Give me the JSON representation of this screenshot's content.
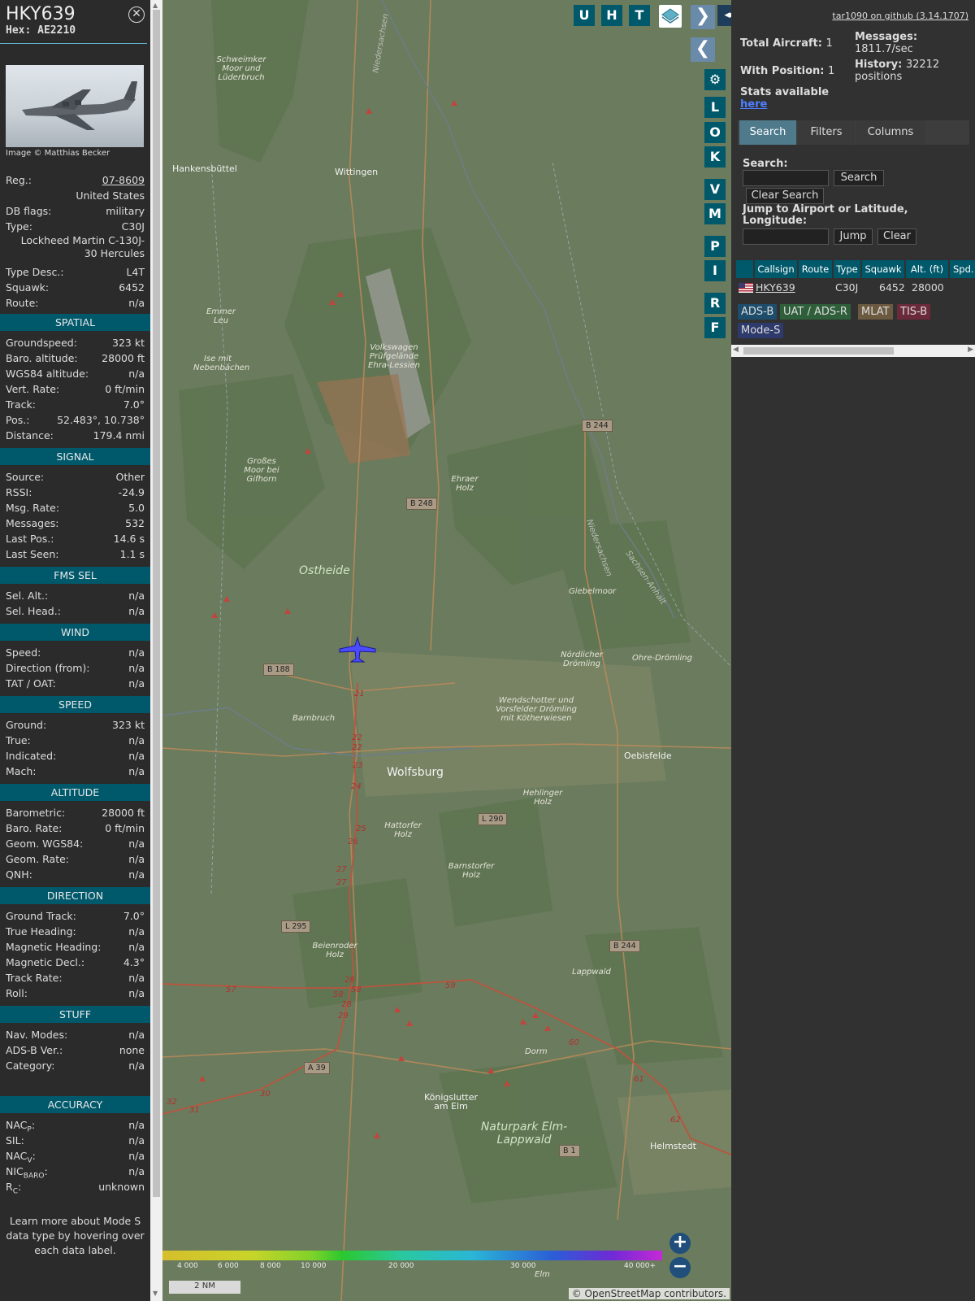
{
  "sidebar": {
    "callsign": "HKY639",
    "hex_label": "Hex:",
    "hex": "AE2210",
    "photo_credit": "Image © Matthias Becker",
    "general": [
      {
        "k": "Reg.:",
        "v": "07-8609",
        "link": true
      },
      {
        "k": "",
        "v": "United States"
      },
      {
        "k": "DB flags:",
        "v": "military"
      },
      {
        "k": "Type:",
        "v": "C30J"
      },
      {
        "k": "",
        "v": "Lockheed Martin C-130J-30 Hercules",
        "tall": true
      },
      {
        "k": "Type Desc.:",
        "v": "L4T"
      },
      {
        "k": "Squawk:",
        "v": "6452"
      },
      {
        "k": "Route:",
        "v": "n/a"
      }
    ],
    "sections": [
      {
        "title": "SPATIAL",
        "rows": [
          {
            "k": "Groundspeed:",
            "v": "323 kt"
          },
          {
            "k": "Baro. altitude:",
            "v": "28000 ft"
          },
          {
            "k": "WGS84 altitude:",
            "v": "n/a"
          },
          {
            "k": "Vert. Rate:",
            "v": "0 ft/min"
          },
          {
            "k": "Track:",
            "v": "7.0°"
          },
          {
            "k": "Pos.:",
            "v": "52.483°, 10.738°"
          },
          {
            "k": "Distance:",
            "v": "179.4 nmi"
          }
        ]
      },
      {
        "title": "SIGNAL",
        "rows": [
          {
            "k": "Source:",
            "v": "Other"
          },
          {
            "k": "RSSI:",
            "v": "-24.9"
          },
          {
            "k": "Msg. Rate:",
            "v": "5.0"
          },
          {
            "k": "Messages:",
            "v": "532"
          },
          {
            "k": "Last Pos.:",
            "v": "14.6 s"
          },
          {
            "k": "Last Seen:",
            "v": "1.1 s"
          }
        ]
      },
      {
        "title": "FMS SEL",
        "rows": [
          {
            "k": "Sel. Alt.:",
            "v": "n/a"
          },
          {
            "k": "Sel. Head.:",
            "v": "n/a"
          }
        ]
      },
      {
        "title": "WIND",
        "rows": [
          {
            "k": "Speed:",
            "v": "n/a"
          },
          {
            "k": "Direction (from):",
            "v": "n/a"
          },
          {
            "k": "TAT / OAT:",
            "v": "n/a"
          }
        ]
      },
      {
        "title": "SPEED",
        "rows": [
          {
            "k": "Ground:",
            "v": "323 kt"
          },
          {
            "k": "True:",
            "v": "n/a"
          },
          {
            "k": "Indicated:",
            "v": "n/a"
          },
          {
            "k": "Mach:",
            "v": "n/a"
          }
        ]
      },
      {
        "title": "ALTITUDE",
        "rows": [
          {
            "k": "Barometric:",
            "v": "28000 ft"
          },
          {
            "k": "Baro. Rate:",
            "v": "0 ft/min"
          },
          {
            "k": "Geom. WGS84:",
            "v": "n/a"
          },
          {
            "k": "Geom. Rate:",
            "v": "n/a"
          },
          {
            "k": "QNH:",
            "v": "n/a"
          }
        ]
      },
      {
        "title": "DIRECTION",
        "rows": [
          {
            "k": "Ground Track:",
            "v": "7.0°"
          },
          {
            "k": "True Heading:",
            "v": "n/a"
          },
          {
            "k": "Magnetic Heading:",
            "v": "n/a"
          },
          {
            "k": "Magnetic Decl.:",
            "v": "4.3°"
          },
          {
            "k": "Track Rate:",
            "v": "n/a"
          },
          {
            "k": "Roll:",
            "v": "n/a"
          }
        ]
      },
      {
        "title": "STUFF",
        "rows": [
          {
            "k": "Nav. Modes:",
            "v": "n/a"
          },
          {
            "k": "ADS-B Ver.:",
            "v": "none"
          },
          {
            "k": "Category:",
            "v": "n/a"
          }
        ]
      },
      {
        "title": "ACCURACY",
        "gap": true,
        "rows": [
          {
            "k": "NAC",
            "sub": "P",
            "v": "n/a"
          },
          {
            "k": "SIL:",
            "v": "n/a"
          },
          {
            "k": "NAC",
            "sub": "V",
            "v": "n/a"
          },
          {
            "k": "NIC",
            "sub": "BARO",
            "v": "n/a"
          },
          {
            "k": "R",
            "sub": "C",
            "v": "unknown"
          }
        ]
      }
    ],
    "footer": "Learn more about Mode S data type by hovering over each data label."
  },
  "map": {
    "top_buttons": [
      "U",
      "H",
      "T"
    ],
    "side_buttons": [
      "L",
      "O",
      "K",
      "V",
      "M",
      "P",
      "I",
      "R",
      "F"
    ],
    "places": [
      {
        "t": "Schweimker Moor und Lüderbruch",
        "it": true
      },
      {
        "t": "Hankensbüttel"
      },
      {
        "t": "Wittingen"
      },
      {
        "t": "Emmer Leu",
        "it": true
      },
      {
        "t": "Ise mit Nebenbächen",
        "it": true
      },
      {
        "t": "Volkswagen Prüfgelände Ehra-Lessien",
        "it": true
      },
      {
        "t": "Großes Moor bei Gifhorn",
        "it": true
      },
      {
        "t": "Ehraer Holz",
        "it": true
      },
      {
        "t": "Ostheide",
        "it": true,
        "big": true
      },
      {
        "t": "Giebelmoor",
        "it": true
      },
      {
        "t": "Nördlicher Drömling",
        "it": true
      },
      {
        "t": "Ohre-Drömling",
        "it": true
      },
      {
        "t": "Barnbruch",
        "it": true
      },
      {
        "t": "Wendschotter und Vorsfelder Drömling mit Kötherwiesen",
        "it": true
      },
      {
        "t": "Oebisfelde"
      },
      {
        "t": "Wolfsburg",
        "big": true
      },
      {
        "t": "Hehlinger Holz",
        "it": true
      },
      {
        "t": "Hattorfer Holz",
        "it": true
      },
      {
        "t": "Barnstorfer Holz",
        "it": true
      },
      {
        "t": "Beienroder Holz",
        "it": true
      },
      {
        "t": "Lappwald",
        "it": true
      },
      {
        "t": "Dorm",
        "it": true
      },
      {
        "t": "Königslutter am Elm"
      },
      {
        "t": "Naturpark Elm-Lappwald",
        "it": true,
        "big": true
      },
      {
        "t": "Helmstedt"
      },
      {
        "t": "Elm",
        "it": true
      }
    ],
    "roads": [
      "B 244",
      "B 248",
      "B 188",
      "L 290",
      "L 295",
      "B 244",
      "A 39",
      "B 1"
    ],
    "altitude_ticks": [
      "4 000",
      "6 000",
      "8 000",
      "10 000",
      "20 000",
      "30 000",
      "40 000+"
    ],
    "scale": "2 NM",
    "attribution": "© OpenStreetMap contributors."
  },
  "right": {
    "github": "tar1090 on github (3.14.1707)",
    "total_aircraft_label": "Total Aircraft:",
    "total_aircraft": "1",
    "with_position_label": "With Position:",
    "with_position": "1",
    "stats_label": "Stats available",
    "stats_link": "here",
    "messages_label": "Messages:",
    "messages": "1811.7/sec",
    "history_label": "History:",
    "history": "32212 positions",
    "tabs": [
      "Search",
      "Filters",
      "Columns"
    ],
    "search_label": "Search:",
    "search_button": "Search",
    "clear_search_button": "Clear Search",
    "jump_label": "Jump to Airport or Latitude, Longitude:",
    "jump_button": "Jump",
    "clear_button": "Clear",
    "columns": [
      "Callsign",
      "Route",
      "Type",
      "Squawk",
      "Alt. (ft)",
      "Spd."
    ],
    "row": {
      "callsign": "HKY639",
      "route": "",
      "type": "C30J",
      "squawk": "6452",
      "alt": "28000"
    },
    "badges": [
      {
        "t": "ADS-B",
        "c": "#1e4d6b"
      },
      {
        "t": "UAT / ADS-R",
        "c": "#2e5e3a"
      },
      {
        "t": "MLAT",
        "c": "#6b5a40"
      },
      {
        "t": "TIS-B",
        "c": "#6b2a3a"
      },
      {
        "t": "Mode-S",
        "c": "#2e3a6b"
      }
    ]
  }
}
